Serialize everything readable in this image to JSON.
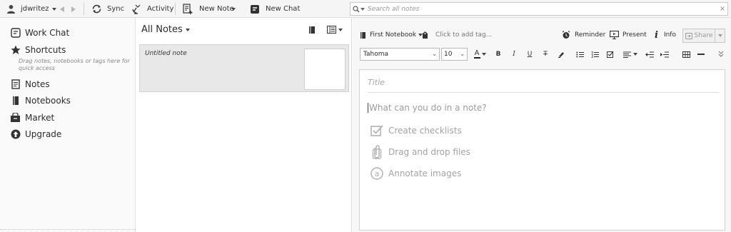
{
  "toolbar": {
    "user": "jdwritez",
    "sync": "Sync",
    "activity": "Activity",
    "new_note": "New Note",
    "new_chat": "New Chat"
  },
  "search": {
    "placeholder": "Search all notes",
    "clear": "×"
  },
  "sidebar": {
    "items": [
      {
        "label": "Work Chat",
        "icon": "chat-icon"
      },
      {
        "label": "Shortcuts",
        "icon": "star-icon"
      },
      {
        "label": "Notes",
        "icon": "note-icon"
      },
      {
        "label": "Notebooks",
        "icon": "notebook-icon"
      },
      {
        "label": "Market",
        "icon": "market-icon"
      },
      {
        "label": "Upgrade",
        "icon": "upgrade-icon"
      }
    ],
    "shortcuts_hint": "Drag notes, notebooks or tags here for quick access"
  },
  "note_list": {
    "title": "All Notes",
    "notes": [
      {
        "title": "Untitled note"
      }
    ]
  },
  "editor": {
    "notebook": "First Notebook",
    "tag_placeholder": "Click to add tag...",
    "reminder": "Reminder",
    "present": "Present",
    "info": "Info",
    "share": "Share",
    "font": "Tahoma",
    "font_size": "10",
    "title_placeholder": "Title",
    "body_placeholder": "What can you do in a note?",
    "tips": [
      "Create checklists",
      "Drag and drop files",
      "Annotate images"
    ]
  },
  "colors": {
    "accent": "#2b2b2b",
    "selected_note_bg": "#e8e8e8",
    "placeholder": "#a3a3a3"
  }
}
